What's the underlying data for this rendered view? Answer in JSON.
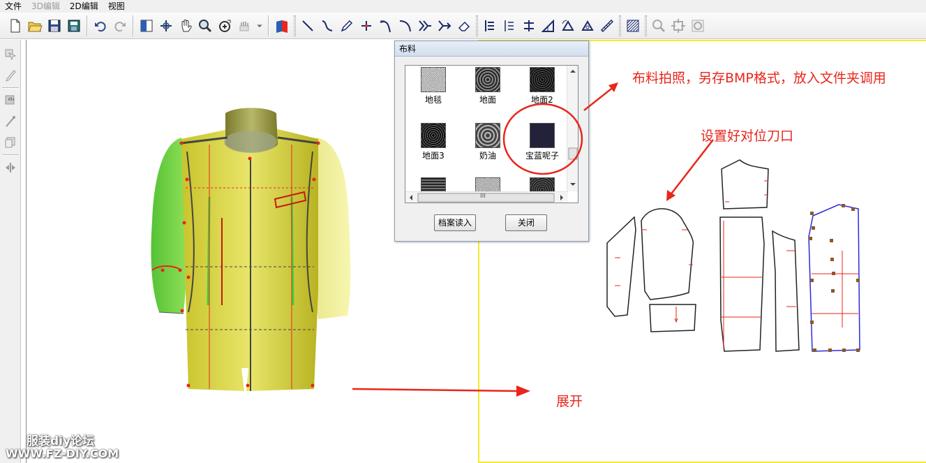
{
  "menu": {
    "items": [
      {
        "label": "文件",
        "enabled": true
      },
      {
        "label": "3D编辑",
        "enabled": false
      },
      {
        "label": "2D编辑",
        "enabled": true
      },
      {
        "label": "视图",
        "enabled": true
      }
    ]
  },
  "toolbar": {
    "icons": [
      "new-file-icon",
      "open-folder-icon",
      "save-icon",
      "save-as-icon",
      "undo-icon",
      "redo-icon",
      "panel-icon",
      "rotate-icon",
      "hand-pan-icon",
      "zoom-icon",
      "view-fit-icon",
      "grab-icon",
      "dropdown-icon",
      "texture-icon",
      "line-icon",
      "curve-icon",
      "pencil-icon",
      "point-icon",
      "bezier-icon",
      "arc-icon",
      "notch-icon",
      "seam-icon",
      "eraser-icon",
      "align-left-icon",
      "align-center-icon",
      "align-distribute-icon",
      "angle-icon",
      "rotate-piece-icon",
      "flip-piece-icon",
      "ruler-icon",
      "hatch-icon",
      "zoom-area-icon",
      "move-icon",
      "refresh-icon"
    ]
  },
  "lefttools": {
    "icons": [
      "select-piece-icon",
      "knife-icon",
      "hand-tool-icon",
      "needle-icon",
      "layer-icon",
      "split-icon"
    ]
  },
  "dialog": {
    "title": "布料",
    "swatches": [
      {
        "label": "地毯",
        "color": "#cfcfcf"
      },
      {
        "label": "地面",
        "color": "#6b6b6b"
      },
      {
        "label": "地面2",
        "color": "#3a3a3a"
      },
      {
        "label": "地面3",
        "color": "#2a2a2a"
      },
      {
        "label": "奶油",
        "color": "#8a8a8a"
      },
      {
        "label": "宝蓝呢子",
        "color": "#22223a"
      },
      {
        "label": "",
        "color": "#555555"
      },
      {
        "label": "",
        "color": "#bdbdbd"
      },
      {
        "label": "",
        "color": "#4a4a4a"
      }
    ],
    "hscroll_label": "III",
    "load_button": "档案读入",
    "close_button": "关闭"
  },
  "annotations": {
    "fabric_note": "布料拍照，另存BMP格式，放入文件夹调用",
    "notch_note": "设置好对位刀口",
    "expand_note": "展开"
  },
  "watermark": {
    "line1": "服装diy论坛",
    "line2": "WWW.FZ-DIY.COM"
  },
  "colors": {
    "annotation": "#e8261b",
    "highlight_border": "#f4ec2a",
    "garment_yellow": "#d9d84a",
    "garment_green": "#7fd84a"
  }
}
